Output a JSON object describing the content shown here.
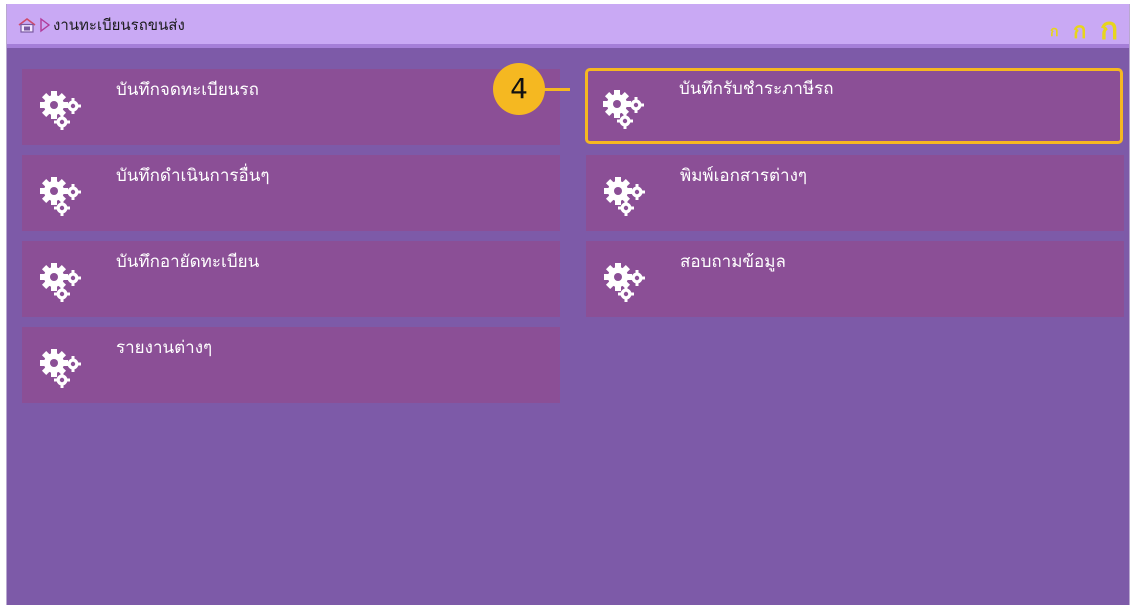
{
  "breadcrumb": {
    "title": "งานทะเบียนรถขนส่ง"
  },
  "font_size_controls": [
    "ก",
    "ก",
    "ก"
  ],
  "menu": {
    "left": [
      {
        "label": "บันทึกจดทะเบียนรถ"
      },
      {
        "label": "บันทึกดำเนินการอื่นๆ"
      },
      {
        "label": "บันทึกอายัดทะเบียน"
      },
      {
        "label": "รายงานต่างๆ"
      }
    ],
    "right": [
      {
        "label": "บันทึกรับชำระภาษีรถ"
      },
      {
        "label": "พิมพ์เอกสารต่างๆ"
      },
      {
        "label": "สอบถามข้อมูล"
      }
    ]
  },
  "callout": {
    "number": "4"
  },
  "colors": {
    "background": "#7d5aa8",
    "topbar": "#c9a9f4",
    "tile": "#8b4f96",
    "highlight": "#f5b821",
    "font_control": "#e7d51d"
  },
  "icons": {
    "home": "home-icon",
    "breadcrumb_arrow": "triangle-right-icon",
    "tile": "gears-icon"
  }
}
